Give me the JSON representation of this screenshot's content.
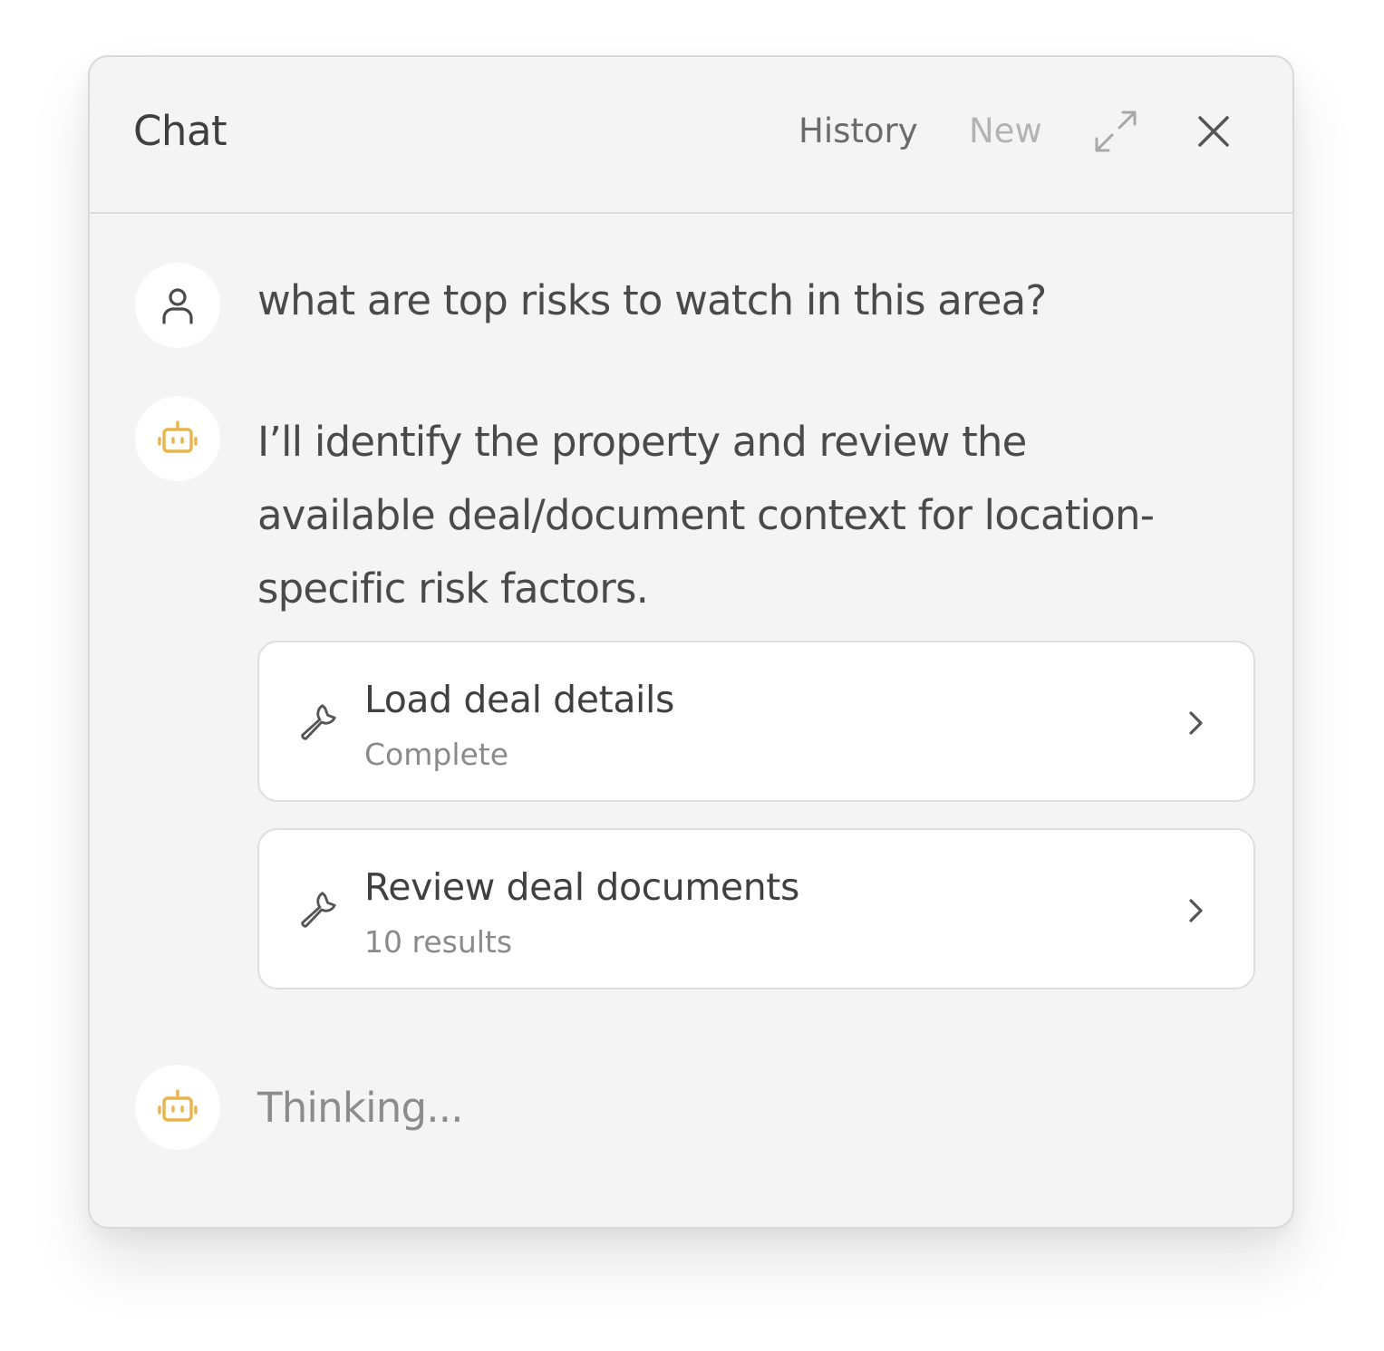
{
  "header": {
    "title": "Chat",
    "history_label": "History",
    "new_label": "New",
    "expand_icon": "expand-icon",
    "close_icon": "close-icon"
  },
  "messages": {
    "user": {
      "icon": "user-icon",
      "text": "what are top risks to watch in this area?"
    },
    "assistant": {
      "icon": "robot-icon",
      "text": "I’ll identify the property and review the available deal/document context for location-specific risk factors."
    },
    "tool_calls": [
      {
        "icon": "wrench-icon",
        "title": "Load deal details",
        "status": "Complete"
      },
      {
        "icon": "wrench-icon",
        "title": "Review deal documents",
        "status": "10 results"
      }
    ],
    "thinking": {
      "icon": "robot-icon",
      "text": "Thinking..."
    }
  },
  "colors": {
    "panel_bg": "#f4f4f4",
    "bot_accent": "#e9b44c",
    "text_primary": "#4a4a4a",
    "text_muted": "#8a8a8a"
  }
}
